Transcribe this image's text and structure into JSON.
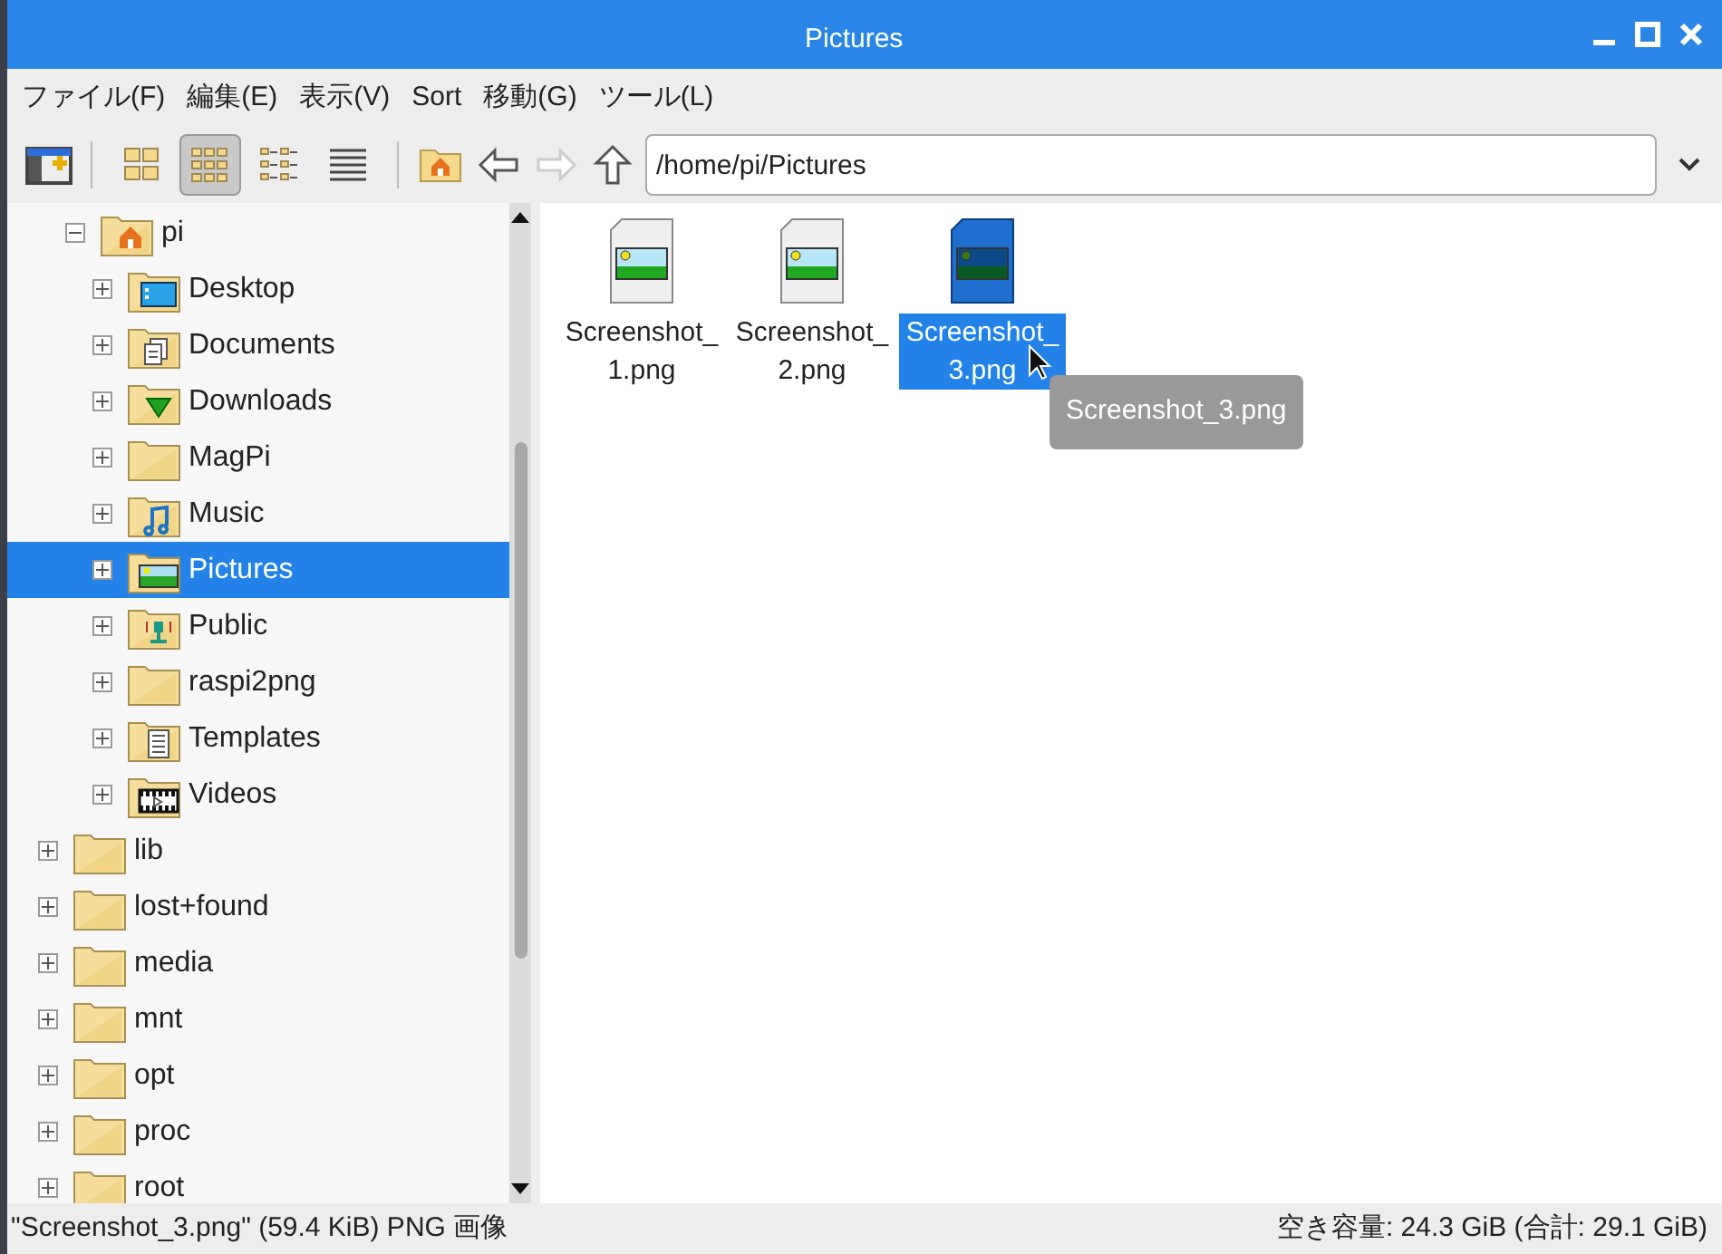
{
  "window": {
    "title": "Pictures"
  },
  "menu": [
    "ファイル(F)",
    "編集(E)",
    "表示(V)",
    "Sort",
    "移動(G)",
    "ツール(L)"
  ],
  "toolbar": {
    "view_modes": [
      {
        "kind": "thumbnails",
        "selected": false
      },
      {
        "kind": "icons",
        "selected": true
      },
      {
        "kind": "compact",
        "selected": false
      },
      {
        "kind": "list",
        "selected": false
      }
    ],
    "forward_disabled": true,
    "back_disabled": false
  },
  "path": {
    "value": "/home/pi/Pictures"
  },
  "tree": {
    "items": [
      {
        "children": [
          {
            "label": "pi",
            "kind": "home",
            "expanded": true,
            "selected": false,
            "children": [
              {
                "label": "Desktop",
                "kind": "desktop",
                "expanded": false,
                "selected": false
              },
              {
                "label": "Documents",
                "kind": "documents",
                "expanded": false,
                "selected": false
              },
              {
                "label": "Downloads",
                "kind": "downloads",
                "expanded": false,
                "selected": false
              },
              {
                "label": "MagPi",
                "kind": "plain",
                "expanded": false,
                "selected": false
              },
              {
                "label": "Music",
                "kind": "music",
                "expanded": false,
                "selected": false
              },
              {
                "label": "Pictures",
                "kind": "pictures",
                "expanded": false,
                "selected": true
              },
              {
                "label": "Public",
                "kind": "public",
                "expanded": false,
                "selected": false
              },
              {
                "label": "raspi2png",
                "kind": "plain",
                "expanded": false,
                "selected": false
              },
              {
                "label": "Templates",
                "kind": "templates",
                "expanded": false,
                "selected": false
              },
              {
                "label": "Videos",
                "kind": "videos",
                "expanded": false,
                "selected": false
              }
            ]
          }
        ]
      },
      {
        "label": "lib",
        "kind": "plain",
        "expanded": false,
        "selected": false
      },
      {
        "label": "lost+found",
        "kind": "plain",
        "expanded": false,
        "selected": false
      },
      {
        "label": "media",
        "kind": "plain",
        "expanded": false,
        "selected": false
      },
      {
        "label": "mnt",
        "kind": "plain",
        "expanded": false,
        "selected": false
      },
      {
        "label": "opt",
        "kind": "plain",
        "expanded": false,
        "selected": false
      },
      {
        "label": "proc",
        "kind": "plain",
        "expanded": false,
        "selected": false
      },
      {
        "label": "root",
        "kind": "plain",
        "expanded": false,
        "selected": false
      }
    ]
  },
  "files": [
    {
      "name": "Screenshot_\n1.png",
      "selected": false
    },
    {
      "name": "Screenshot_\n2.png",
      "selected": false
    },
    {
      "name": "Screenshot_\n3.png",
      "selected": true
    }
  ],
  "tooltip": "Screenshot_3.png",
  "status_bar": {
    "left": "\"Screenshot_3.png\" (59.4 KiB) PNG 画像",
    "right": "空き容量: 24.3 GiB (合計: 29.1 GiB)"
  }
}
